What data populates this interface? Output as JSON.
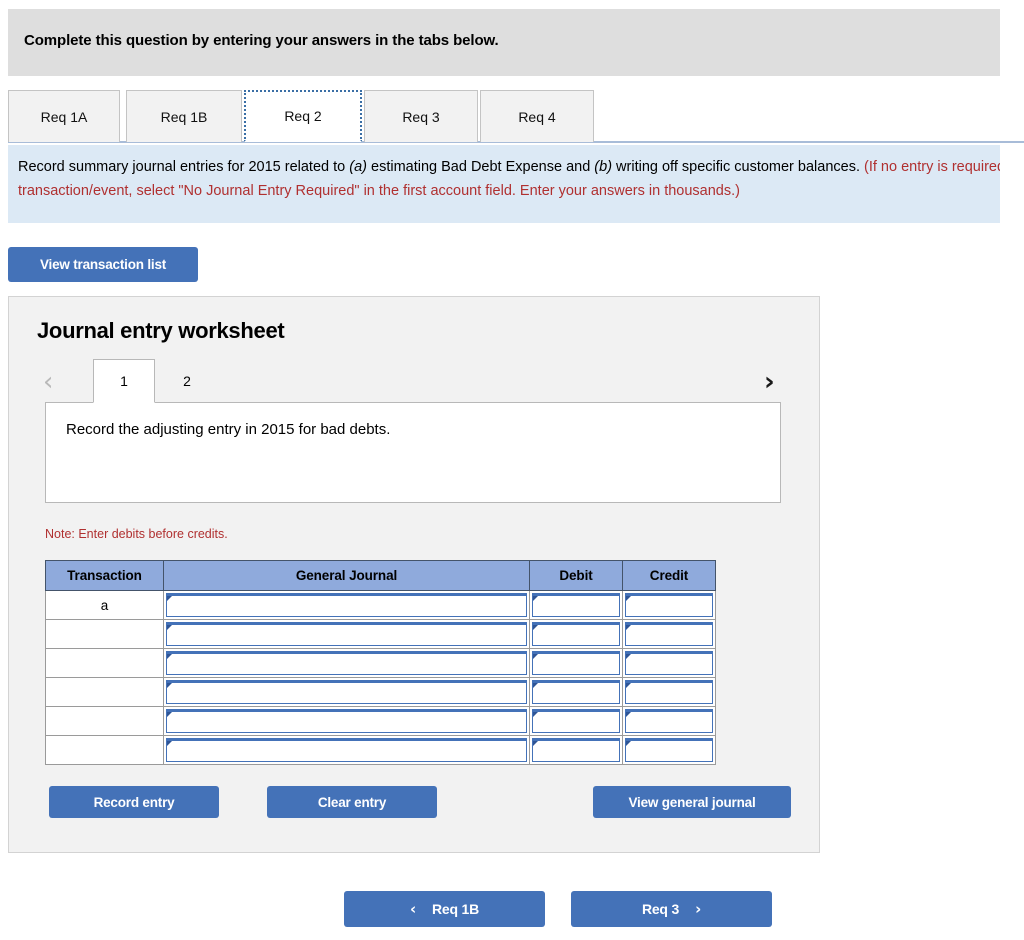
{
  "banner": {
    "text": "Complete this question by entering your answers in the tabs below."
  },
  "tabs": {
    "items": [
      {
        "label": "Req 1A",
        "active": false
      },
      {
        "label": "Req 1B",
        "active": false
      },
      {
        "label": "Req 2",
        "active": true
      },
      {
        "label": "Req 3",
        "active": false
      },
      {
        "label": "Req 4",
        "active": false
      }
    ]
  },
  "requirement": {
    "lead_1": "Record summary journal entries for 2015 related to ",
    "italic_a": "(a)",
    "lead_2": " estimating Bad Debt Expense and ",
    "italic_b": "(b)",
    "lead_3": " writing off specific customer balances. ",
    "red_note": "(If no entry is required for a transaction/event, select \"No Journal Entry Required\" in the first account field. Enter your answers in thousands.)"
  },
  "toolbar": {
    "view_transaction_list_label": "View transaction list"
  },
  "worksheet": {
    "title": "Journal entry worksheet",
    "prev_icon": "chevron-left-icon",
    "next_icon": "chevron-right-icon",
    "pages": [
      {
        "label": "1",
        "active": true
      },
      {
        "label": "2",
        "active": false
      }
    ],
    "prompt": "Record the adjusting entry in 2015 for bad debts.",
    "note": "Note: Enter debits before credits.",
    "table": {
      "headers": [
        "Transaction",
        "General Journal",
        "Debit",
        "Credit"
      ],
      "rows": [
        {
          "transaction": "a",
          "general_journal": "",
          "debit": "",
          "credit": ""
        },
        {
          "transaction": "",
          "general_journal": "",
          "debit": "",
          "credit": ""
        },
        {
          "transaction": "",
          "general_journal": "",
          "debit": "",
          "credit": ""
        },
        {
          "transaction": "",
          "general_journal": "",
          "debit": "",
          "credit": ""
        },
        {
          "transaction": "",
          "general_journal": "",
          "debit": "",
          "credit": ""
        },
        {
          "transaction": "",
          "general_journal": "",
          "debit": "",
          "credit": ""
        }
      ]
    },
    "buttons": {
      "record_entry": "Record entry",
      "clear_entry": "Clear entry",
      "view_general_journal": "View general journal"
    }
  },
  "footer": {
    "prev_label": "Req 1B",
    "prev_icon": "chevron-left-icon",
    "next_label": "Req 3",
    "next_icon": "chevron-right-icon"
  },
  "colors": {
    "accent_blue": "#4472b8",
    "table_header_blue": "#8faadc",
    "banner_gray": "#dedede",
    "info_blue": "#dce9f5",
    "red_note": "#b03030"
  }
}
